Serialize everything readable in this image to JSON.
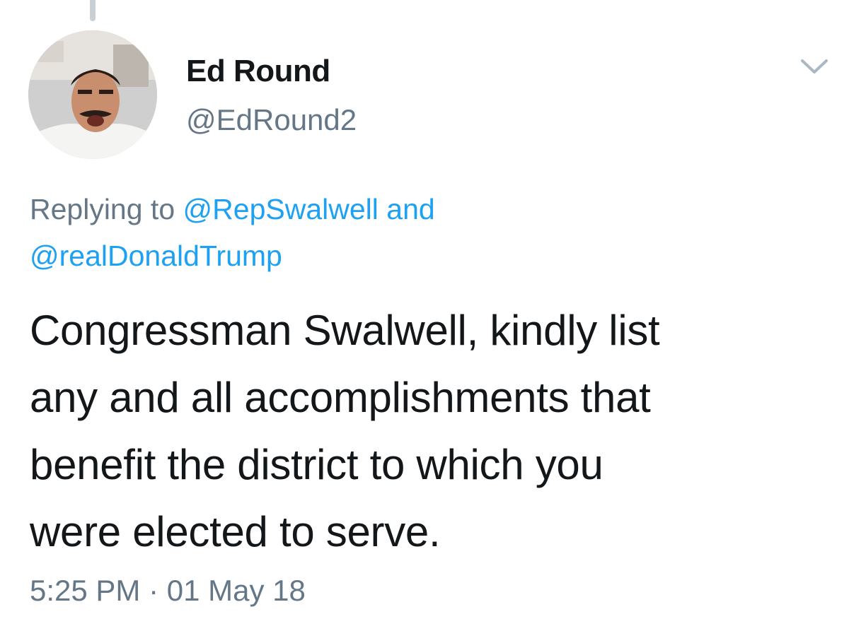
{
  "author": {
    "display_name": "Ed Round",
    "handle": "@EdRound2"
  },
  "reply": {
    "prefix": "Replying to",
    "mention1": "@RepSwalwell",
    "conjunction": "and",
    "mention2": "@realDonaldTrump"
  },
  "tweet": {
    "lines": [
      "Congressman Swalwell, kindly list",
      "any and all accomplishments that",
      "benefit the district to which you",
      "were elected to serve."
    ],
    "timestamp": "5:25 PM · 01 May 18"
  },
  "icons": {
    "menu": "chevron-down-icon"
  },
  "colors": {
    "text": "#14171a",
    "muted": "#657786",
    "link": "#1da1f2",
    "chevron": "#aab8c2"
  }
}
